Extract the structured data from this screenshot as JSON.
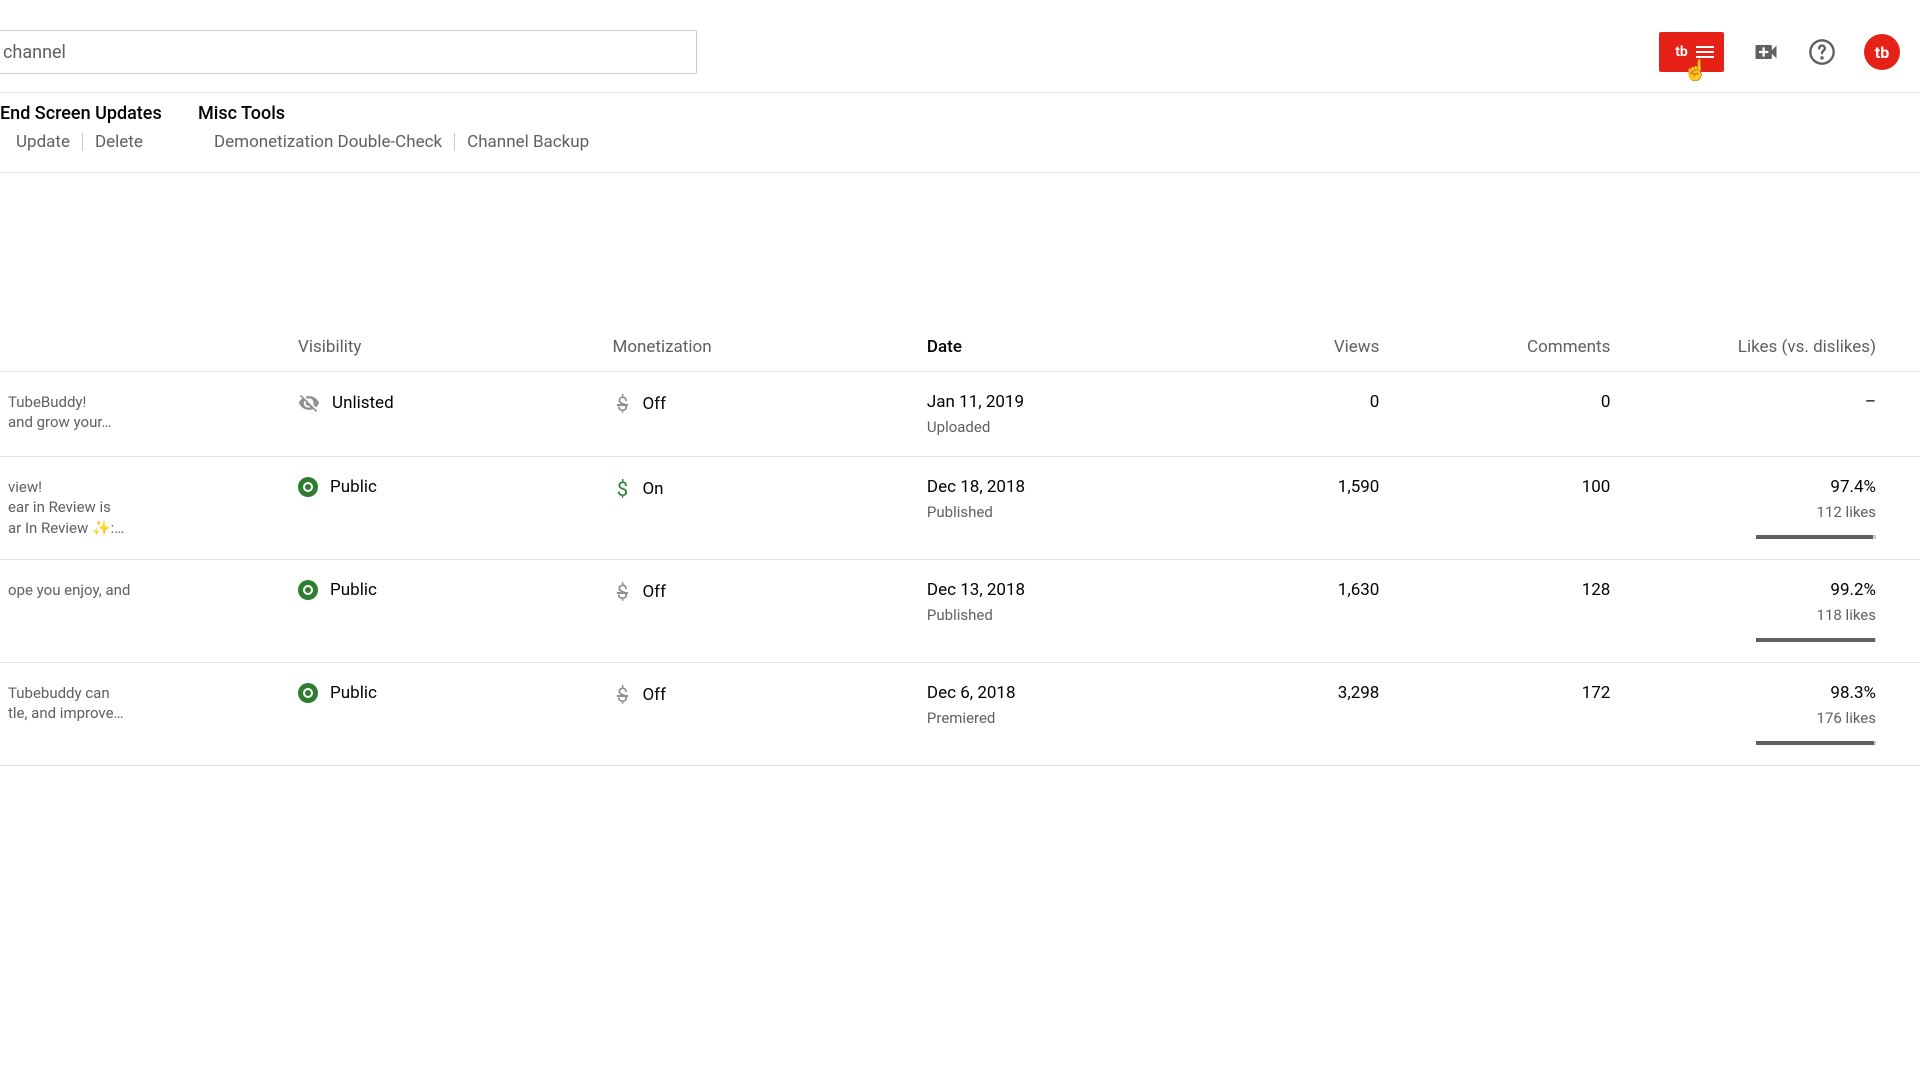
{
  "search": {
    "placeholder": "channel"
  },
  "topbar": {
    "tb_label": "tb"
  },
  "toolbar": {
    "groups": [
      {
        "title": "End Screen Updates",
        "links": [
          "Update",
          "Delete"
        ]
      },
      {
        "title": "Misc Tools",
        "links": [
          "Demonetization Double-Check",
          "Channel Backup"
        ]
      }
    ]
  },
  "table": {
    "columns": {
      "visibility": "Visibility",
      "monetization": "Monetization",
      "date": "Date",
      "views": "Views",
      "comments": "Comments",
      "likes": "Likes (vs. dislikes)"
    },
    "rows": [
      {
        "title_frag": "TubeBuddy!",
        "desc_frag": "and grow your…",
        "visibility": "Unlisted",
        "monetization": "Off",
        "date": "Jan 11, 2019",
        "date_sub": "Uploaded",
        "views": "0",
        "comments": "0",
        "likes_pct": "–",
        "likes_count": "",
        "likes_fill": 0,
        "show_bar": false
      },
      {
        "title_frag": "view!",
        "desc_frag": "ear in Review is",
        "desc_frag2": "ar In Review ✨:…",
        "visibility": "Public",
        "monetization": "On",
        "date": "Dec 18, 2018",
        "date_sub": "Published",
        "views": "1,590",
        "comments": "100",
        "likes_pct": "97.4%",
        "likes_count": "112 likes",
        "likes_fill": 97.4,
        "show_bar": true
      },
      {
        "title_frag": "",
        "desc_frag": "ope you enjoy, and",
        "visibility": "Public",
        "monetization": "Off",
        "date": "Dec 13, 2018",
        "date_sub": "Published",
        "views": "1,630",
        "comments": "128",
        "likes_pct": "99.2%",
        "likes_count": "118 likes",
        "likes_fill": 99.2,
        "show_bar": true
      },
      {
        "title_frag": "",
        "desc_frag": "Tubebuddy can",
        "desc_frag2": "tle, and improve…",
        "visibility": "Public",
        "monetization": "Off",
        "date": "Dec 6, 2018",
        "date_sub": "Premiered",
        "views": "3,298",
        "comments": "172",
        "likes_pct": "98.3%",
        "likes_count": "176 likes",
        "likes_fill": 98.3,
        "show_bar": true
      }
    ]
  }
}
